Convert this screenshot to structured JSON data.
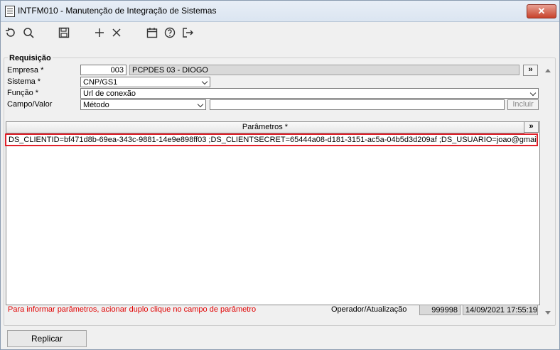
{
  "window": {
    "title": "INTFM010 - Manutenção de Integração de Sistemas",
    "close_label": "✕"
  },
  "toolbar": {
    "icons": [
      "refresh-icon",
      "search-icon",
      "save-icon",
      "add-icon",
      "delete-icon",
      "calendar-icon",
      "help-icon",
      "exit-icon"
    ]
  },
  "requisicao": {
    "group_label": "Requisição",
    "empresa_label": "Empresa *",
    "empresa_code": "003",
    "empresa_name": "PCPDES 03 - DIOGO",
    "expand_label": "»",
    "sistema_label": "Sistema *",
    "sistema_value": "CNP/GS1",
    "funcao_label": "Função *",
    "funcao_value": "Url de conexão",
    "campo_label": "Campo/Valor",
    "campo_value": "Método",
    "valor_value": "",
    "incluir_label": "Incluir"
  },
  "parametros": {
    "header": "Parâmetros *",
    "expand_label": "»",
    "line": "DS_CLIENTID=bf471d8b-69ea-343c-9881-14e9e898ff03 ;DS_CLIENTSECRET=65444a08-d181-3151-ac5a-04b5d3d209af ;DS_USUARIO=joao@gmail.com"
  },
  "footer": {
    "hint": "Para informar parâmetros, acionar duplo clique no campo de parâmetro",
    "operador_label": "Operador/Atualização",
    "operador_value": "999998",
    "updated_value": "14/09/2021 17:55:19",
    "replicar_label": "Replicar"
  },
  "colors": {
    "accent_red": "#e0202a",
    "hint_red": "#e00000"
  }
}
